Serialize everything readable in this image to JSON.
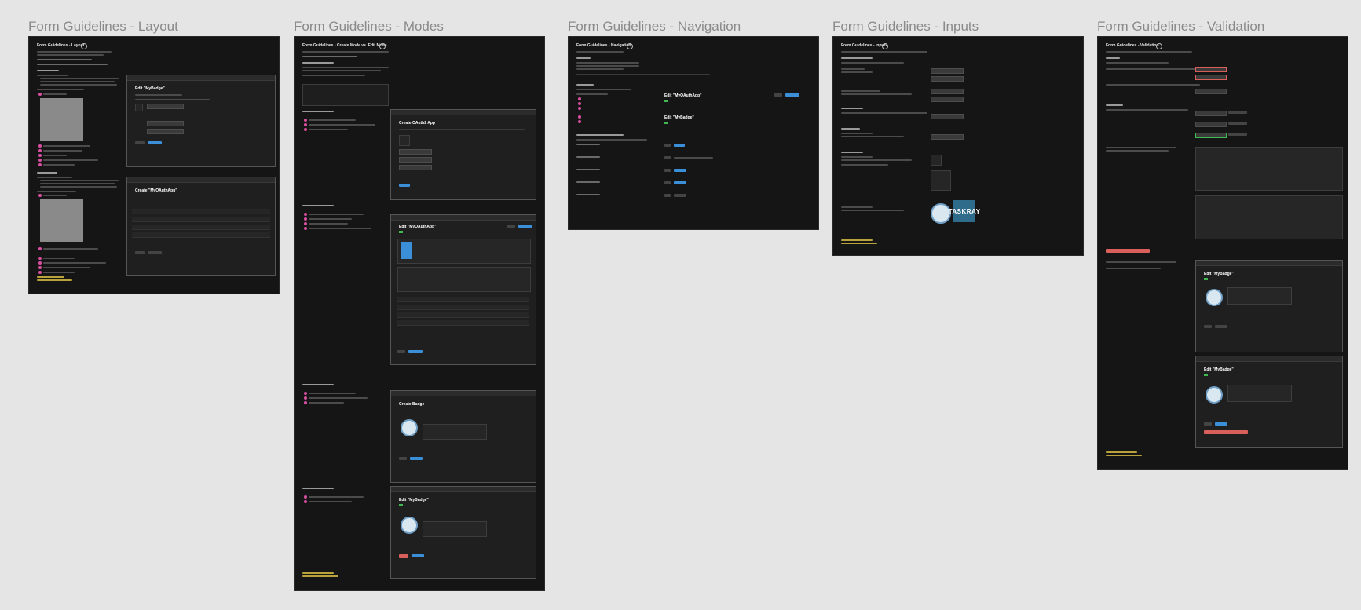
{
  "canvas": {
    "background": "#e5e5e5"
  },
  "frames": {
    "layout": {
      "label": "Form Guidelines - Layout",
      "board_title": "Form Guidelines - Layout",
      "mock1_title": "Edit \"MyBadge\"",
      "mock2_title": "Create \"MyOAuthApp\""
    },
    "modes": {
      "label": "Form Guidelines - Modes",
      "board_title": "Form Guidelines - Create Mode vs. Edit Mode",
      "mock1_title": "Create OAuth2 App",
      "mock2_title": "Edit \"MyOAuthApp\"",
      "mock3_title": "Create Badge",
      "mock4_title": "Edit \"MyBadge\""
    },
    "navigation": {
      "label": "Form Guidelines - Navigation",
      "board_title": "Form Guidelines - Navigation",
      "mock1_title": "Edit \"MyOAuthApp\"",
      "mock2_title": "Edit \"MyBadge\""
    },
    "inputs": {
      "label": "Form Guidelines - Inputs",
      "board_title": "Form Guidelines - Inputs",
      "logo_text": "TASKRAY"
    },
    "validation": {
      "label": "Form Guidelines - Validation",
      "board_title": "Form Guidelines - Validation",
      "mock1_title": "Edit \"MyBadge\"",
      "mock2_title": "Edit \"MyBadge\""
    }
  },
  "colors": {
    "board": "#151515",
    "accent_blue": "#3a8fd8",
    "bullet_pink": "#d94fa0",
    "error_red": "#d9605a",
    "note_yellow": "#b8a23a",
    "success_green": "#3fb950"
  }
}
